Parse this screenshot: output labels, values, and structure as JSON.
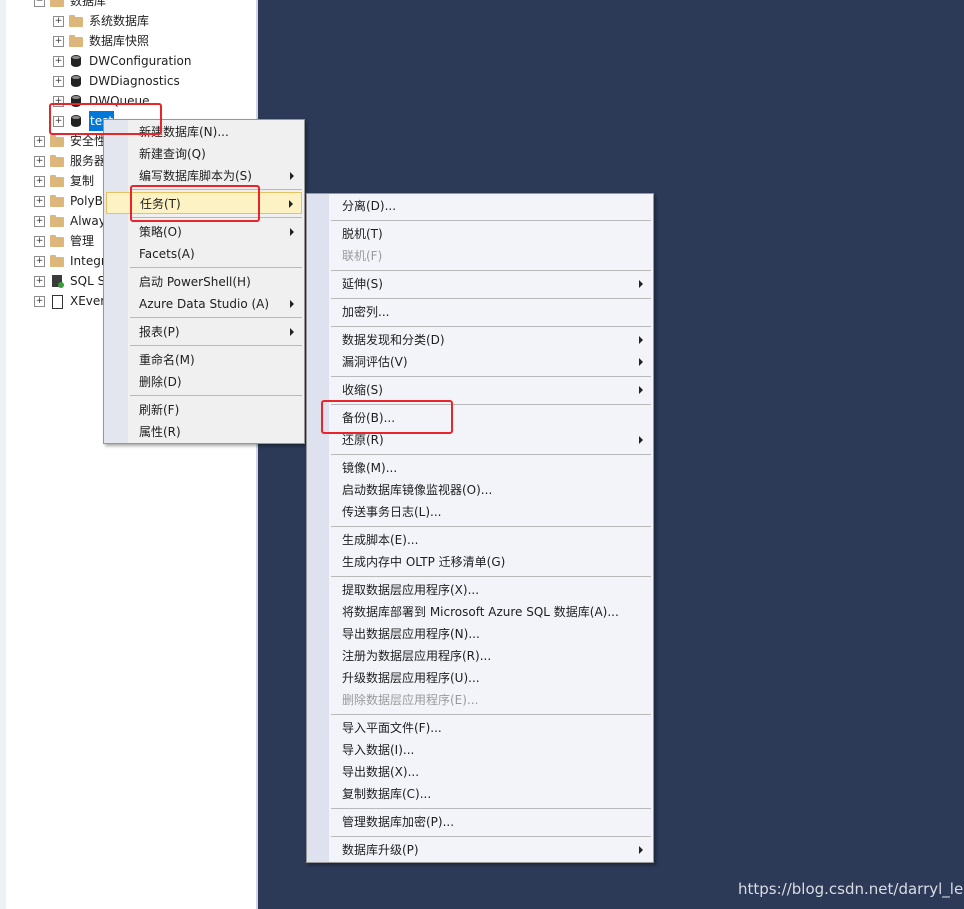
{
  "tree": {
    "databases_label": "数据库",
    "items": [
      {
        "label": "系统数据库"
      },
      {
        "label": "数据库快照"
      },
      {
        "label": "DWConfiguration"
      },
      {
        "label": "DWDiagnostics"
      },
      {
        "label": "DWQueue"
      },
      {
        "label": "test"
      },
      {
        "label": "安全性"
      },
      {
        "label": "服务器对象"
      },
      {
        "label": "复制"
      },
      {
        "label": "PolyBase"
      },
      {
        "label": "Always On 高可用性"
      },
      {
        "label": "管理"
      },
      {
        "label": "Integration Services 目录"
      },
      {
        "label": "SQL Server 代理"
      },
      {
        "label": "XEvent 探查器"
      }
    ],
    "expander_minus": "−",
    "expander_plus": "+"
  },
  "context_menu": {
    "items": [
      {
        "label": "新建数据库(N)..."
      },
      {
        "label": "新建查询(Q)"
      },
      {
        "label": "编写数据库脚本为(S)"
      },
      {
        "label": "任务(T)"
      },
      {
        "label": "策略(O)"
      },
      {
        "label": "Facets(A)"
      },
      {
        "label": "启动 PowerShell(H)"
      },
      {
        "label": "Azure Data Studio (A)"
      },
      {
        "label": "报表(P)"
      },
      {
        "label": "重命名(M)"
      },
      {
        "label": "删除(D)"
      },
      {
        "label": "刷新(F)"
      },
      {
        "label": "属性(R)"
      }
    ]
  },
  "tasks_submenu": {
    "items": [
      {
        "label": "分离(D)..."
      },
      {
        "label": "脱机(T)"
      },
      {
        "label": "联机(F)"
      },
      {
        "label": "延伸(S)"
      },
      {
        "label": "加密列..."
      },
      {
        "label": "数据发现和分类(D)"
      },
      {
        "label": "漏洞评估(V)"
      },
      {
        "label": "收缩(S)"
      },
      {
        "label": "备份(B)..."
      },
      {
        "label": "还原(R)"
      },
      {
        "label": "镜像(M)..."
      },
      {
        "label": "启动数据库镜像监视器(O)..."
      },
      {
        "label": "传送事务日志(L)..."
      },
      {
        "label": "生成脚本(E)..."
      },
      {
        "label": "生成内存中 OLTP 迁移清单(G)"
      },
      {
        "label": "提取数据层应用程序(X)..."
      },
      {
        "label": "将数据库部署到 Microsoft Azure SQL 数据库(A)..."
      },
      {
        "label": "导出数据层应用程序(N)..."
      },
      {
        "label": "注册为数据层应用程序(R)..."
      },
      {
        "label": "升级数据层应用程序(U)..."
      },
      {
        "label": "删除数据层应用程序(E)..."
      },
      {
        "label": "导入平面文件(F)..."
      },
      {
        "label": "导入数据(I)..."
      },
      {
        "label": "导出数据(X)..."
      },
      {
        "label": "复制数据库(C)..."
      },
      {
        "label": "管理数据库加密(P)..."
      },
      {
        "label": "数据库升级(P)"
      }
    ]
  },
  "watermark": "https://blog.csdn.net/darryl_lee",
  "colors": {
    "background": "#2c3a58",
    "selection": "#0078d7",
    "highlight": "#fcf2c4",
    "annotation": "#e8262a"
  }
}
